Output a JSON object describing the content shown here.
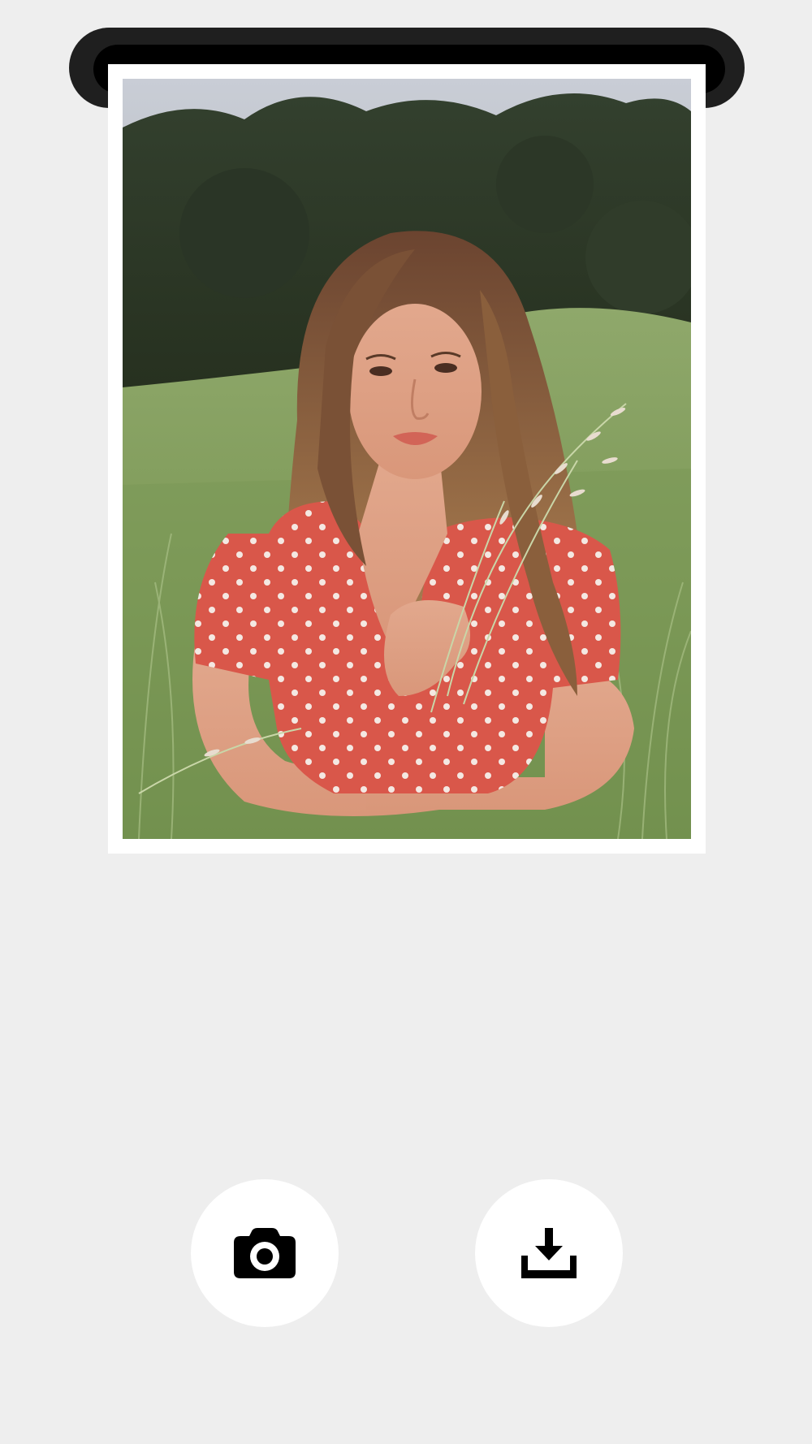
{
  "printer": {
    "slot_color": "#1f1f1f"
  },
  "photo": {
    "description_icon": "portrait-photo",
    "frame_color": "#ffffff"
  },
  "actions": {
    "camera": {
      "icon": "camera-icon"
    },
    "download": {
      "icon": "download-icon"
    }
  }
}
